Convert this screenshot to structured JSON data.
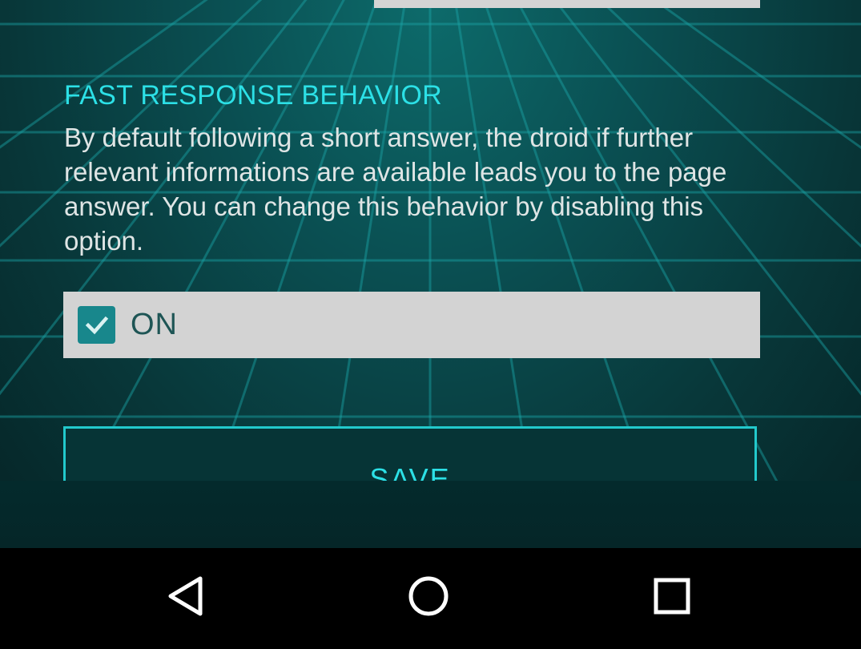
{
  "settings": {
    "section_title": "FAST RESPONSE BEHAVIOR",
    "description": "By default following a short answer, the droid if further relevant informations are available leads you to the page answer. You can change this behavior by disabling this option.",
    "toggle": {
      "label": "ON",
      "checked": true
    },
    "save_label": "SAVE"
  },
  "navbar": {
    "back_icon": "back-triangle-icon",
    "home_icon": "home-circle-icon",
    "recents_icon": "recents-square-icon"
  },
  "colors": {
    "accent": "#2ce0e6",
    "background": "#0a4f52",
    "checkbox": "#18878c",
    "row_background": "#d3d3d3"
  }
}
